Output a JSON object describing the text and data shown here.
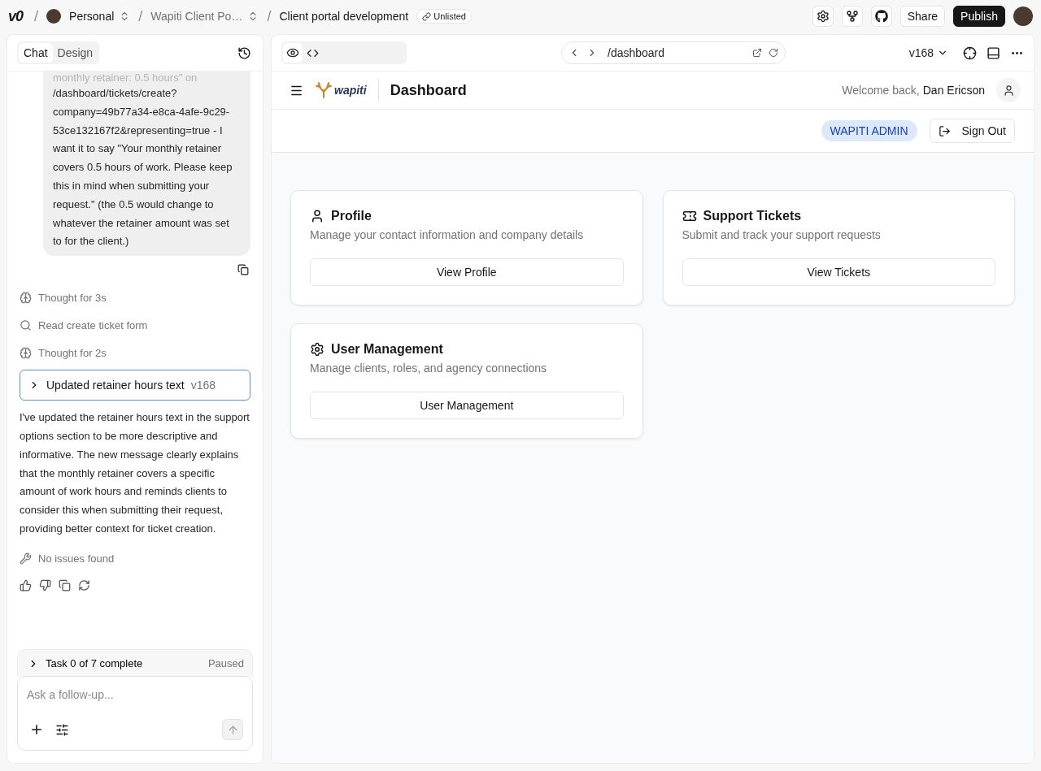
{
  "topbar": {
    "logo": "v0",
    "separator": "/",
    "breadcrumbs": [
      {
        "kind": "account",
        "label": "Personal"
      },
      {
        "kind": "project",
        "label": "Wapiti Client Po…"
      },
      {
        "kind": "chat",
        "label": "Client portal development"
      }
    ],
    "visibility": "Unlisted",
    "share": "Share",
    "publish": "Publish"
  },
  "chat": {
    "tabs": [
      {
        "label": "Chat",
        "selected": true
      },
      {
        "label": "Design",
        "selected": false
      }
    ],
    "message": {
      "faded_line": "monthly retainer: 0.5 hours\" on",
      "text": "/dashboard/tickets/create? company=49b77a34-e8ca-4afe-9c29-53ce132167f2&representing=true - I want it to say \"Your monthly retainer covers 0.5 hours of work. Please keep this in mind when submitting your request.\" (the 0.5 would change to whatever the retainer amount was set to for the client.)"
    },
    "steps": [
      {
        "kind": "thought",
        "label": "Thought for 3s"
      },
      {
        "kind": "read",
        "label": "Read create ticket form"
      },
      {
        "kind": "thought",
        "label": "Thought for 2s"
      }
    ],
    "version_card": {
      "label": "Updated retainer hours text",
      "version": "v168",
      "expanded": false
    },
    "reply": "I've updated the retainer hours text in the support options section to be more descriptive and informative. The new message clearly explains that the monthly retainer covers a specific amount of work hours and reminds clients to consider this when submitting their request, providing better context for ticket creation.",
    "check": "No issues found",
    "tasks": {
      "label": "Task 0 of 7 complete",
      "status": "Paused",
      "expanded": false
    },
    "input": {
      "placeholder": "Ask a follow-up..."
    }
  },
  "preview": {
    "modes": [
      {
        "kind": "preview",
        "selected": true
      },
      {
        "kind": "code",
        "selected": false
      }
    ],
    "url": "/dashboard",
    "version": "v168",
    "app": {
      "brand": "wapiti",
      "title": "Dashboard",
      "welcome": "Welcome back,",
      "user": "Dan Ericson",
      "role": "WAPITI ADMIN",
      "sign_out": "Sign Out",
      "cards": [
        {
          "kind": "profile",
          "title": "Profile",
          "description": "Manage your contact information and company details",
          "button": "View Profile"
        },
        {
          "kind": "tickets",
          "title": "Support Tickets",
          "description": "Submit and track your support requests",
          "button": "View Tickets"
        },
        {
          "kind": "users",
          "title": "User Management",
          "description": "Manage clients, roles, and agency connections",
          "button": "User Management"
        }
      ]
    }
  }
}
